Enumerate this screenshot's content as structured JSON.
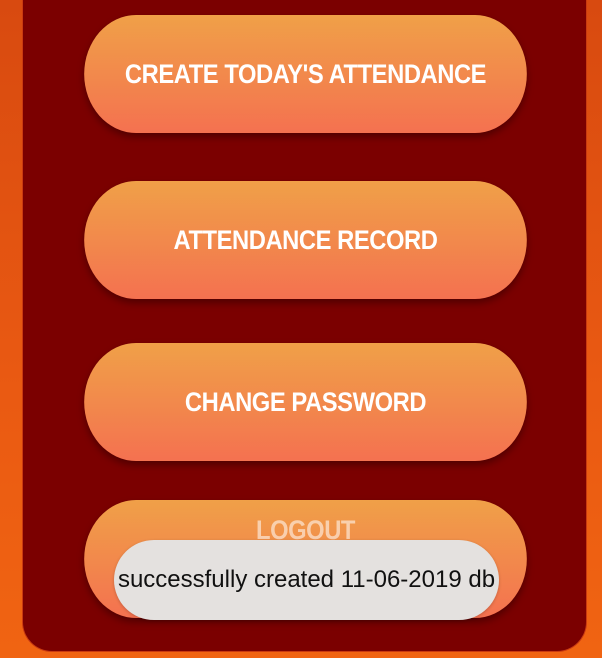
{
  "menu": {
    "create_attendance_label": "CREATE TODAY'S ATTENDANCE",
    "attendance_record_label": "ATTENDANCE RECORD",
    "change_password_label": "CHANGE PASSWORD",
    "logout_label": "LOGOUT"
  },
  "toast": {
    "message": "successfully created 11-06-2019 db"
  },
  "colors": {
    "background": "#e85a12",
    "panel": "#7b0000",
    "button_top": "#f0a048",
    "button_bottom": "#f47150",
    "toast_bg": "#e4e1df"
  }
}
